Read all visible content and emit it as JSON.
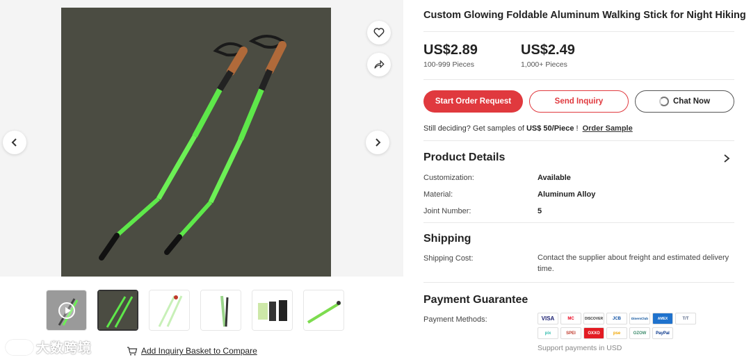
{
  "product": {
    "title": "Custom Glowing Foldable Aluminum Walking Stick for Night Hiking"
  },
  "prices": [
    {
      "amount": "US$2.89",
      "quantity": "100-999 Pieces"
    },
    {
      "amount": "US$2.49",
      "quantity": "1,000+ Pieces"
    }
  ],
  "actions": {
    "order": "Start Order Request",
    "inquiry": "Send Inquiry",
    "chat": "Chat Now"
  },
  "samples": {
    "prefix": "Still deciding? Get samples of ",
    "price": "US$ 50/Piece",
    "suffix": " !",
    "link": "Order Sample"
  },
  "details": {
    "title": "Product Details",
    "rows": [
      {
        "label": "Customization:",
        "value": "Available"
      },
      {
        "label": "Material:",
        "value": "Aluminum Alloy"
      },
      {
        "label": "Joint Number:",
        "value": "5"
      }
    ]
  },
  "shipping": {
    "title": "Shipping",
    "label": "Shipping Cost:",
    "value": "Contact the supplier about freight and estimated delivery time."
  },
  "payment": {
    "title": "Payment Guarantee",
    "label": "Payment Methods:",
    "methods": [
      "VISA",
      "MC",
      "DISCOVER",
      "JCB",
      "DinersClub",
      "AMEX",
      "T/T",
      "pix",
      "SPEI",
      "OXXO",
      "pse",
      "OZOW",
      "PayPal"
    ],
    "note": "Support payments in USD"
  },
  "gallery": {
    "basket_link": "Add Inquiry Basket to Compare",
    "watermark": "大数跨境"
  },
  "colors": {
    "accent": "#e0393e",
    "glow": "#5ee84a"
  }
}
